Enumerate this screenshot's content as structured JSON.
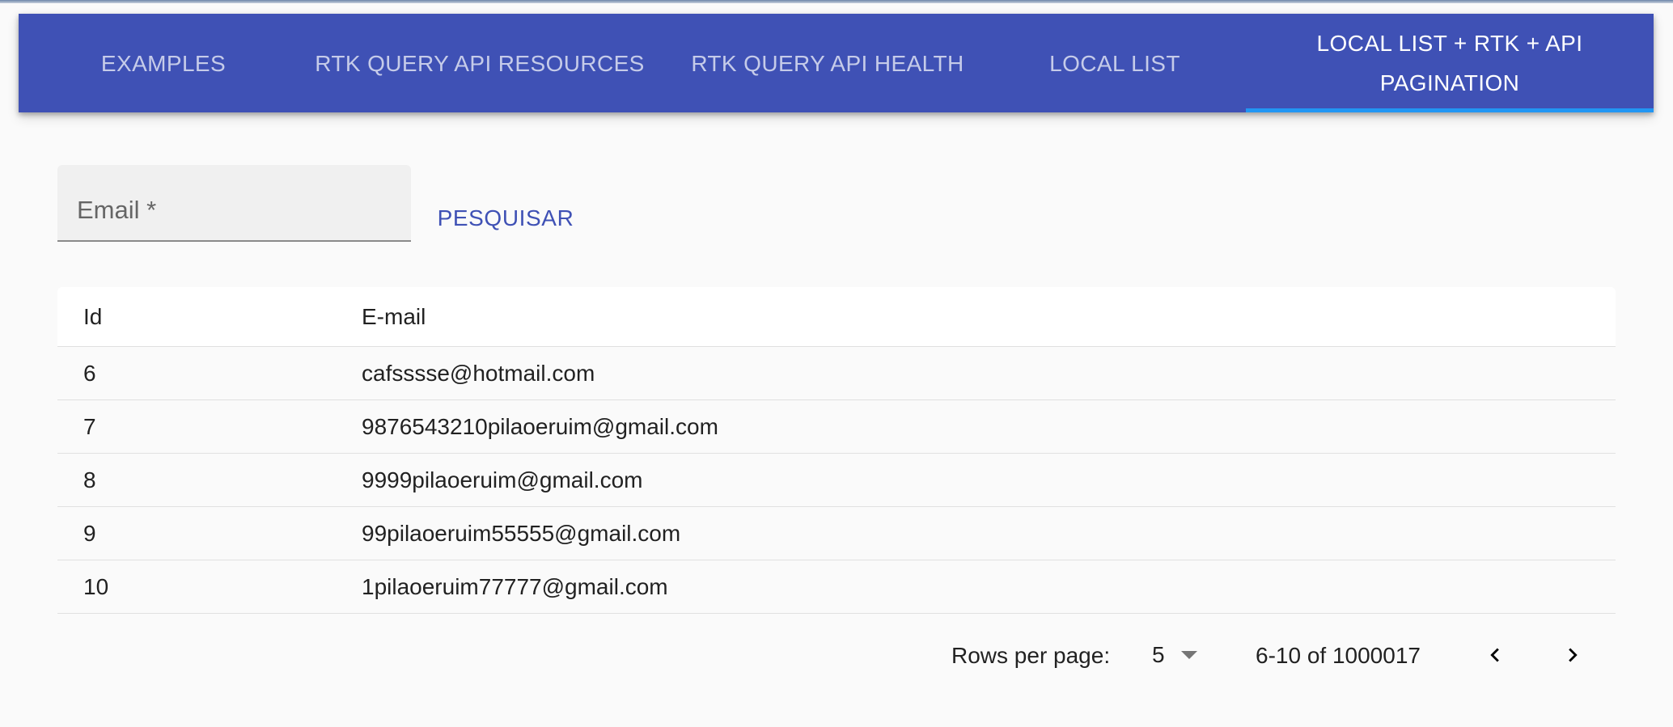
{
  "tabs": [
    {
      "label": "EXAMPLES"
    },
    {
      "label": "RTK QUERY API RESOURCES"
    },
    {
      "label": "RTK QUERY API HEALTH"
    },
    {
      "label": "LOCAL LIST"
    },
    {
      "label_line1": "LOCAL LIST + RTK + API",
      "label_line2": "PAGINATION"
    }
  ],
  "search": {
    "placeholder": "Email *",
    "button_label": "PESQUISAR"
  },
  "table": {
    "headers": {
      "id": "Id",
      "email": "E-mail"
    },
    "rows": [
      {
        "id": "6",
        "email": "cafsssse@hotmail.com"
      },
      {
        "id": "7",
        "email": "9876543210pilaoeruim@gmail.com"
      },
      {
        "id": "8",
        "email": "9999pilaoeruim@gmail.com"
      },
      {
        "id": "9",
        "email": "99pilaoeruim55555@gmail.com"
      },
      {
        "id": "10",
        "email": "1pilaoeruim77777@gmail.com"
      }
    ]
  },
  "pagination": {
    "rows_per_page_label": "Rows per page:",
    "rows_per_page_value": "5",
    "range_text": "6-10 of 1000017"
  },
  "icons": {
    "dropdown": "caret-down-icon",
    "prev": "chevron-left-icon",
    "next": "chevron-right-icon"
  },
  "colors": {
    "appbar": "#3f51b5",
    "indicator": "#2196f3",
    "primary": "#3f51b5"
  }
}
